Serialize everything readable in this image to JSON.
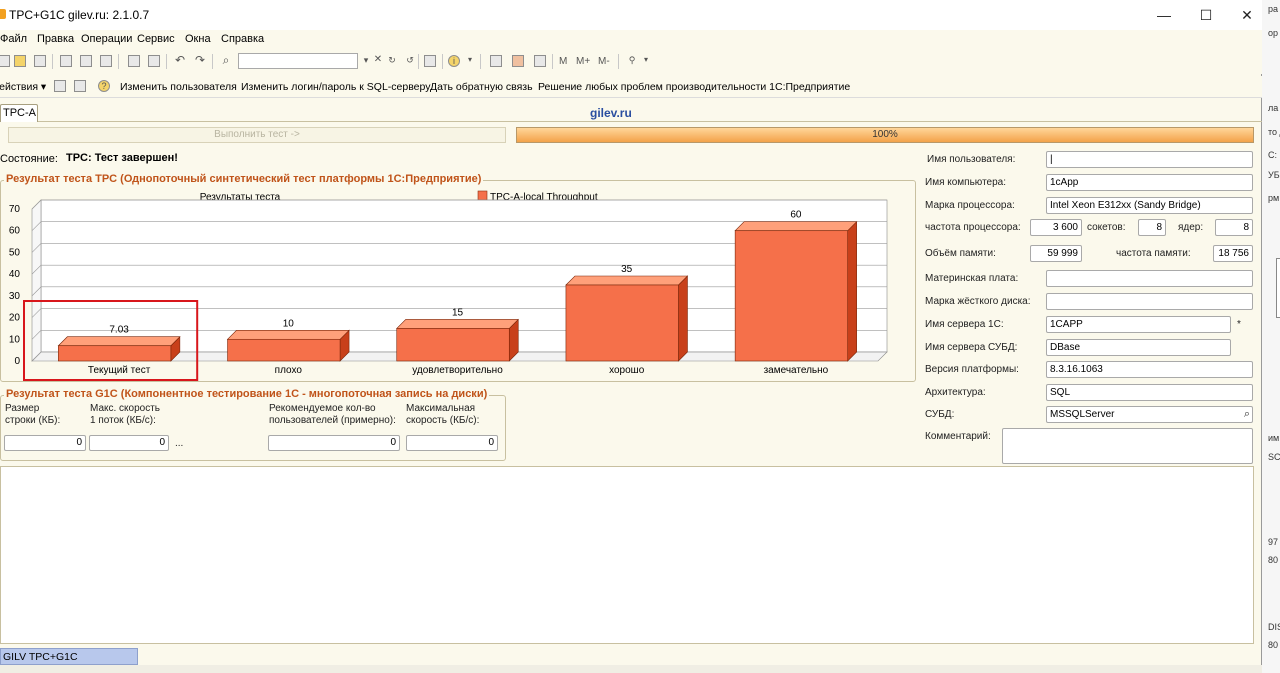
{
  "window": {
    "title": "TPC+G1C gilev.ru: 2.1.0.7",
    "controls": {
      "minimize": "—",
      "maximize": "☐",
      "close": "✕"
    }
  },
  "menu": [
    "Файл",
    "Правка",
    "Операции",
    "Сервис",
    "Окна",
    "Справка"
  ],
  "toolbar": {
    "text_items": [
      "M",
      "M+",
      "M-"
    ]
  },
  "actions": {
    "menu_label": "Действия",
    "items": [
      "Изменить пользователя",
      "Изменить логин/пароль к SQL-серверу",
      "Дать обратную связь",
      "Решение любых проблем производительности 1С:Предприятие"
    ]
  },
  "tab": {
    "label": "TPC-A"
  },
  "site_label": "gilev.ru",
  "run_button": {
    "label": "Выполнить тест ->"
  },
  "progress": {
    "value": 100,
    "text": "100%"
  },
  "state": {
    "label": "Состояние:",
    "value": "TPC: Тест завершен!"
  },
  "tpc_group": {
    "title": "Результат теста TPC (Однопоточный синтетический тест платформы 1С:Предприятие)"
  },
  "chart_data": {
    "type": "bar",
    "title": "Результаты теста",
    "categories": [
      "Текущий тест",
      "плохо",
      "удовлетворительно",
      "хорошо",
      "замечательно"
    ],
    "series": [
      {
        "name": "TPC-A-local Throughput",
        "values": [
          7.03,
          10,
          15,
          35,
          60
        ],
        "labels": [
          "7.03",
          "10",
          "15",
          "35",
          "60"
        ]
      }
    ],
    "ylim": [
      0,
      70
    ],
    "yticks": [
      "0",
      "10",
      "20",
      "30",
      "40",
      "50",
      "60",
      "70"
    ],
    "grid": true,
    "legend_position": "top",
    "bar_color": "#f5704a",
    "highlight_color": "#d8161b"
  },
  "g1c_group": {
    "title": "Результат теста G1C (Компонентное тестирование 1С - многопоточная запись на диски)",
    "fields": [
      {
        "label_line1": "Размер",
        "label_line2": "строки (КБ):",
        "value": "0"
      },
      {
        "label_line1": "Макс. скорость",
        "label_line2": "1 поток (КБ/с):",
        "value": "0"
      },
      {
        "label_line1": "Рекомендуемое кол-во",
        "label_line2": "пользователей (примерно):",
        "value": "0"
      },
      {
        "label_line1": "Максимальная",
        "label_line2": "скорость (КБ/с):",
        "value": "0"
      }
    ],
    "ellipsis": "..."
  },
  "props": {
    "user_label": "Имя пользователя:",
    "user_value": "|",
    "computer_label": "Имя компьютера:",
    "computer_value": "1cApp",
    "cpu_label": "Марка процессора:",
    "cpu_value": "Intel Xeon E312xx (Sandy Bridge)",
    "freq_label": "частота процессора:",
    "freq_value": "3 600",
    "sockets_label": "сокетов:",
    "sockets_value": "8",
    "cores_label": "ядер:",
    "cores_value": "8",
    "mem_label": "Объём памяти:",
    "mem_value": "59 999",
    "memfreq_label": "частота памяти:",
    "memfreq_value": "18 756",
    "mb_label": "Материнская плата:",
    "mb_value": "",
    "hdd_label": "Марка жёсткого диска:",
    "hdd_value": "",
    "server1c_label": "Имя сервера 1С:",
    "server1c_value": "1CAPP",
    "server1c_suffix": "*",
    "dbserver_label": "Имя сервера СУБД:",
    "dbserver_value": "DBase",
    "platform_label": "Версия платформы:",
    "platform_value": "8.3.16.1063",
    "arch_label": "Архитектура:",
    "arch_value": "SQL",
    "dbms_label": "СУБД:",
    "dbms_value": "MSSQLServer",
    "comment_label": "Комментарий:",
    "comment_value": ""
  },
  "bottom_tab": {
    "label": "GILV TPC+G1C"
  },
  "right_strip": [
    "ра",
    "ор",
    "ла",
    "то Д",
    "С:",
    "УБ",
    "рм",
    "им",
    "SC",
    "97",
    "80",
    "DIS",
    "80"
  ]
}
